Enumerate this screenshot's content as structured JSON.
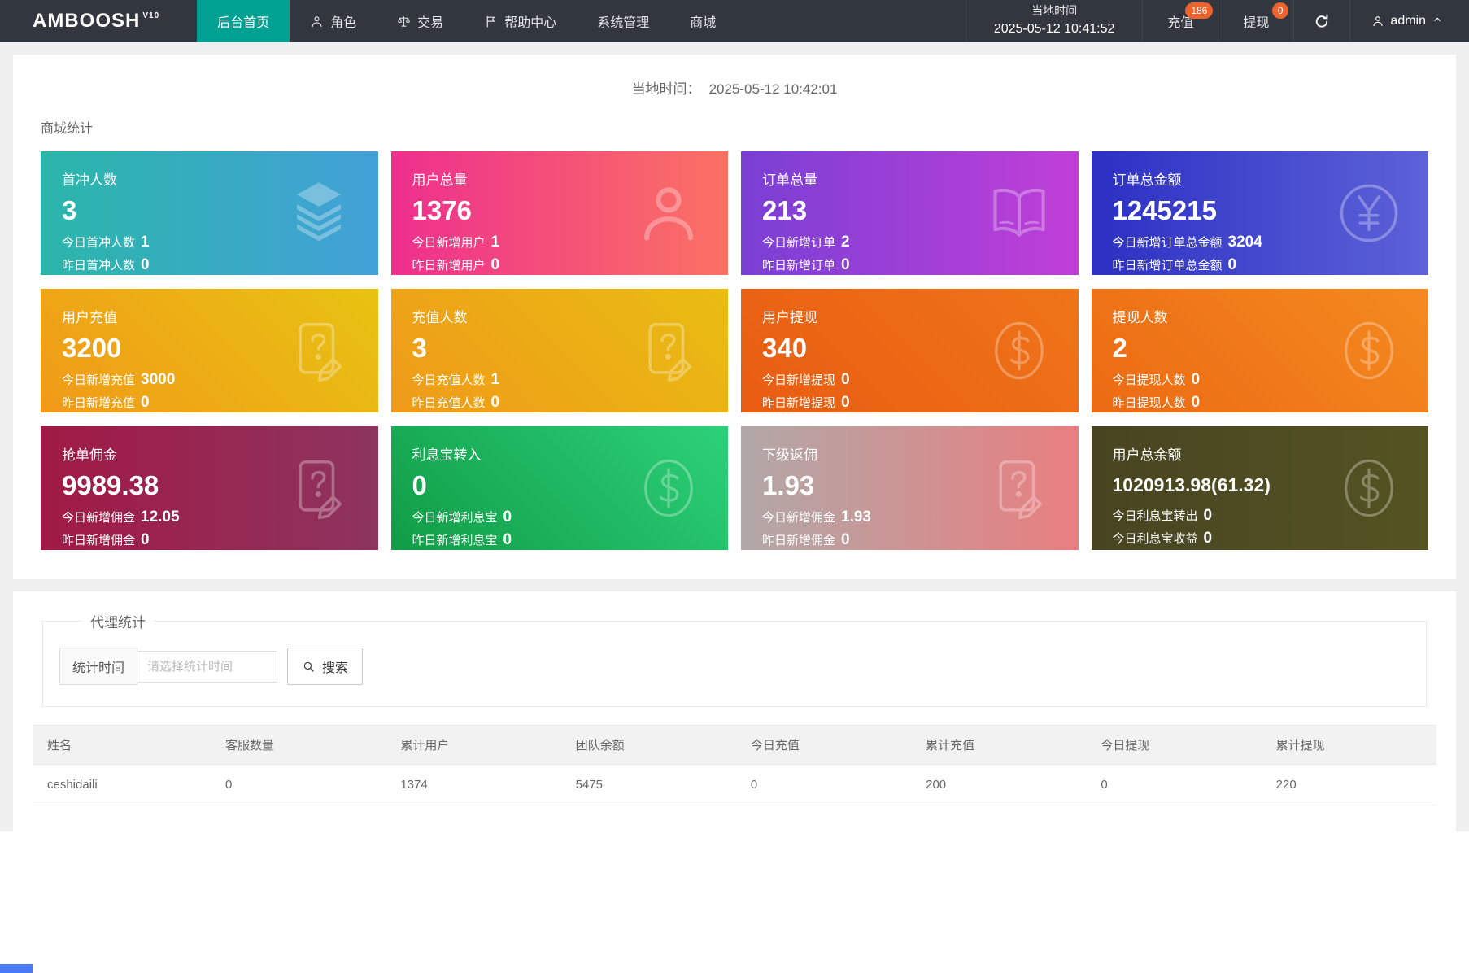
{
  "colors": {
    "nav_bg": "#32363f",
    "nav_active": "#00a093",
    "badge": "#ed632e",
    "page_bg": "#efefef",
    "bottom_bar": "#4a79f5"
  },
  "navbar": {
    "logo": "AMBOOSH",
    "logo_sup": "V10",
    "items": [
      {
        "key": "home",
        "label": "后台首页",
        "active": true
      },
      {
        "key": "roles",
        "label": "角色",
        "icon": "user-icon"
      },
      {
        "key": "trade",
        "label": "交易",
        "icon": "scale-icon"
      },
      {
        "key": "help",
        "label": "帮助中心",
        "icon": "flag-icon"
      },
      {
        "key": "system",
        "label": "系统管理"
      },
      {
        "key": "mall",
        "label": "商城"
      }
    ],
    "local_time_label": "当地时间",
    "local_time_value": "2025-05-12 10:41:52",
    "recharge": {
      "label": "充值",
      "badge": "186"
    },
    "withdraw": {
      "label": "提现",
      "badge": "0"
    },
    "user": "admin"
  },
  "main": {
    "time_label": "当地时间：",
    "time_value": "2025-05-12 10:42:01",
    "section_title": "商城统计",
    "cards": [
      {
        "title": "首冲人数",
        "value": "3",
        "lines": [
          [
            "今日首冲人数",
            "1"
          ],
          [
            "昨日首冲人数",
            "0"
          ]
        ],
        "icon": "layers-icon",
        "bg": "linear-gradient(to right,#2bb6aa,#43a1d8)"
      },
      {
        "title": "用户总量",
        "value": "1376",
        "lines": [
          [
            "今日新增用户",
            "1"
          ],
          [
            "昨日新增用户",
            "0"
          ]
        ],
        "icon": "user-icon",
        "bg": "linear-gradient(to right,#ee2f8e,#fb7263)"
      },
      {
        "title": "订单总量",
        "value": "213",
        "lines": [
          [
            "今日新增订单",
            "2"
          ],
          [
            "昨日新增订单",
            "0"
          ]
        ],
        "icon": "book-icon",
        "bg": "linear-gradient(to right,#7a3fd4,#c13fd8)"
      },
      {
        "title": "订单总金额",
        "value": "1245215",
        "lines": [
          [
            "今日新增订单总金额",
            "3204"
          ],
          [
            "昨日新增订单总金额",
            "0"
          ]
        ],
        "icon": "yen-icon",
        "bg": "linear-gradient(to right,#2c30c3,#5d62d8)"
      },
      {
        "title": "用户充值",
        "value": "3200",
        "lines": [
          [
            "今日新增充值",
            "3000"
          ],
          [
            "昨日新增充值",
            "0"
          ]
        ],
        "icon": "doc-edit-icon",
        "bg": "linear-gradient(45deg,#f09a18,#e8c312)"
      },
      {
        "title": "充值人数",
        "value": "3",
        "lines": [
          [
            "今日充值人数",
            "1"
          ],
          [
            "昨日充值人数",
            "0"
          ]
        ],
        "icon": "doc-edit-icon",
        "bg": "linear-gradient(45deg,#ef9a19,#e9bd12)"
      },
      {
        "title": "用户提现",
        "value": "340",
        "lines": [
          [
            "今日新增提现",
            "0"
          ],
          [
            "昨日新增提现",
            "0"
          ]
        ],
        "icon": "dollar-icon",
        "bg": "linear-gradient(45deg,#e85c12,#ef7519)"
      },
      {
        "title": "提现人数",
        "value": "2",
        "lines": [
          [
            "今日提现人数",
            "0"
          ],
          [
            "昨日提现人数",
            "0"
          ]
        ],
        "icon": "dollar-icon",
        "bg": "linear-gradient(45deg,#ec6a14,#f48a1f)"
      },
      {
        "title": "抢单佣金",
        "value": "9989.38",
        "lines": [
          [
            "今日新增佣金",
            "12.05"
          ],
          [
            "昨日新增佣金",
            "0"
          ]
        ],
        "icon": "doc-edit-icon",
        "bg": "linear-gradient(to right,#a01a45,#8d345f)"
      },
      {
        "title": "利息宝转入",
        "value": "0",
        "lines": [
          [
            "今日新增利息宝",
            "0"
          ],
          [
            "昨日新增利息宝",
            "0"
          ]
        ],
        "icon": "dollar-icon",
        "bg": "linear-gradient(45deg,#119c46,#2cd17a)"
      },
      {
        "title": "下级返佣",
        "value": "1.93",
        "lines": [
          [
            "今日新增佣金",
            "1.93"
          ],
          [
            "昨日新增佣金",
            "0"
          ]
        ],
        "icon": "doc-edit-icon",
        "bg": "linear-gradient(to right,#b1a8a7,#e97e80)"
      },
      {
        "title": "用户总余额",
        "value": "1020913.98(61.32)",
        "value_small": true,
        "lines": [
          [
            "今日利息宝转出",
            "0"
          ],
          [
            "今日利息宝收益",
            "0"
          ]
        ],
        "icon": "dollar-icon",
        "bg": "linear-gradient(to right,#474521,#555322)"
      }
    ]
  },
  "agent": {
    "legend": "代理统计",
    "filter_label": "统计时间",
    "filter_placeholder": "请选择统计时间",
    "search_label": "搜索",
    "table": {
      "headers": [
        "姓名",
        "客服数量",
        "累计用户",
        "团队余额",
        "今日充值",
        "累计充值",
        "今日提现",
        "累计提现"
      ],
      "rows": [
        [
          "ceshidaili",
          "0",
          "1374",
          "5475",
          "0",
          "200",
          "0",
          "220"
        ]
      ]
    }
  }
}
